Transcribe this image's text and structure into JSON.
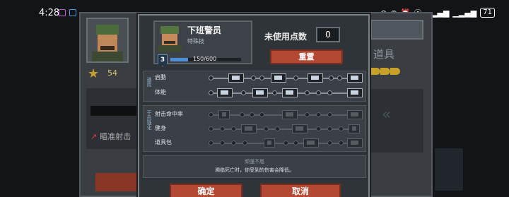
{
  "status_bar": {
    "time": "4:28",
    "battery": "71"
  },
  "background": {
    "level": "54",
    "skill_tag": "瞄准射击",
    "tools_label": "道具"
  },
  "modal": {
    "character": {
      "name": "下班警员",
      "subtitle": "特殊技",
      "level": "3",
      "xp_text": "150/600",
      "xp_progress": 0.25
    },
    "unused_points_label": "未使用点数",
    "unused_points_value": "0",
    "reset_label": "重置",
    "section_a": {
      "tag": "通用",
      "rows": [
        {
          "label": "启動"
        },
        {
          "label": "体能"
        }
      ]
    },
    "section_b": {
      "tag": "干员强化",
      "rows": [
        {
          "label": "射击命中率"
        },
        {
          "label": "健身"
        },
        {
          "label": "道具包"
        }
      ]
    },
    "description": {
      "title": "顽强不屈",
      "text": "濒临死亡时，你受到的伤害会降低。"
    },
    "confirm_label": "确定",
    "cancel_label": "取消"
  }
}
